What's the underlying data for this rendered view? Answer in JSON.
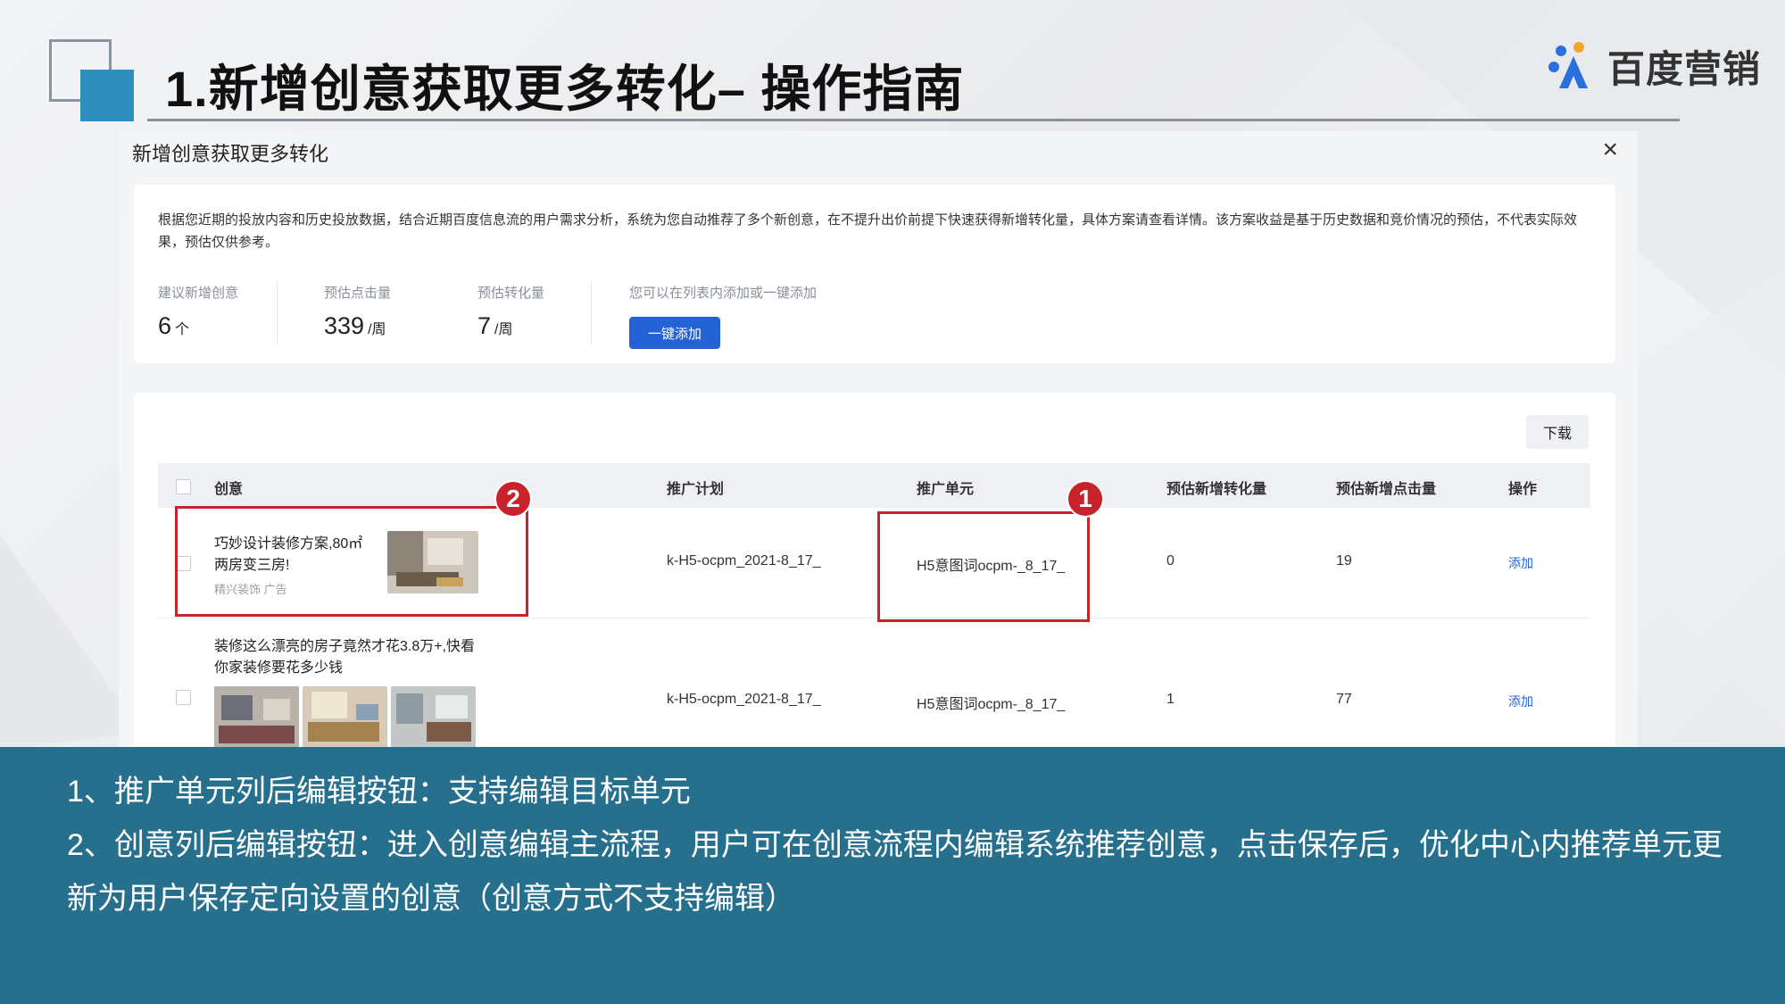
{
  "slide": {
    "title": "1.新增创意获取更多转化– 操作指南"
  },
  "brand": {
    "name": "百度营销",
    "accent": "#2e8fbe",
    "logo_colors": [
      "#2a6fdb",
      "#f2a42a"
    ]
  },
  "modal": {
    "title": "新增创意获取更多转化",
    "close_icon": "close-icon",
    "description": "根据您近期的投放内容和历史投放数据，结合近期百度信息流的用户需求分析，系统为您自动推荐了多个新创意，在不提升出价前提下快速获得新增转化量，具体方案请查看详情。该方案收益是基于历史数据和竞价情况的预估，不代表实际效果，预估仅供参考。",
    "stats": [
      {
        "label": "建议新增创意",
        "value": "6",
        "unit": "个"
      },
      {
        "label": "预估点击量",
        "value": "339",
        "unit": "/周"
      },
      {
        "label": "预估转化量",
        "value": "7",
        "unit": "/周"
      }
    ],
    "add_hint": "您可以在列表内添加或一键添加",
    "add_all_label": "一键添加",
    "download_label": "下载",
    "table": {
      "headers": [
        "创意",
        "推广计划",
        "推广单元",
        "预估新增转化量",
        "预估新增点击量",
        "操作"
      ],
      "rows": [
        {
          "title": "巧妙设计装修方案,80㎡ 两房变三房!",
          "title_line1": "巧妙设计装修方案,80㎡",
          "title_line2": "两房变三房!",
          "meta": "精兴装饰 广告",
          "plan": "k-H5-ocpm_2021-8_17_",
          "unit": "H5意图词ocpm-_8_17_",
          "conv": "0",
          "clicks": "19",
          "action": "添加"
        },
        {
          "title": "装修这么漂亮的房子竟然才花3.8万+,快看你家装修要花多少钱",
          "title_line1": "装修这么漂亮的房子竟然才花3.8万+,快看",
          "title_line2": "你家装修要花多少钱",
          "plan": "k-H5-ocpm_2021-8_17_",
          "unit": "H5意图词ocpm-_8_17_",
          "conv": "1",
          "clicks": "77",
          "action": "添加"
        }
      ]
    },
    "markers": [
      "1",
      "2"
    ],
    "highlight_color": "#c8222a",
    "button_color": "#2463d6"
  },
  "notes": [
    "1、推广单元列后编辑按钮：支持编辑目标单元",
    "2、创意列后编辑按钮：进入创意编辑主流程，用户可在创意流程内编辑系统推荐创意，点击保存后，优化中心内推荐单元更新为用户保存定向设置的创意（创意方式不支持编辑）"
  ],
  "band_color": "#27708d"
}
